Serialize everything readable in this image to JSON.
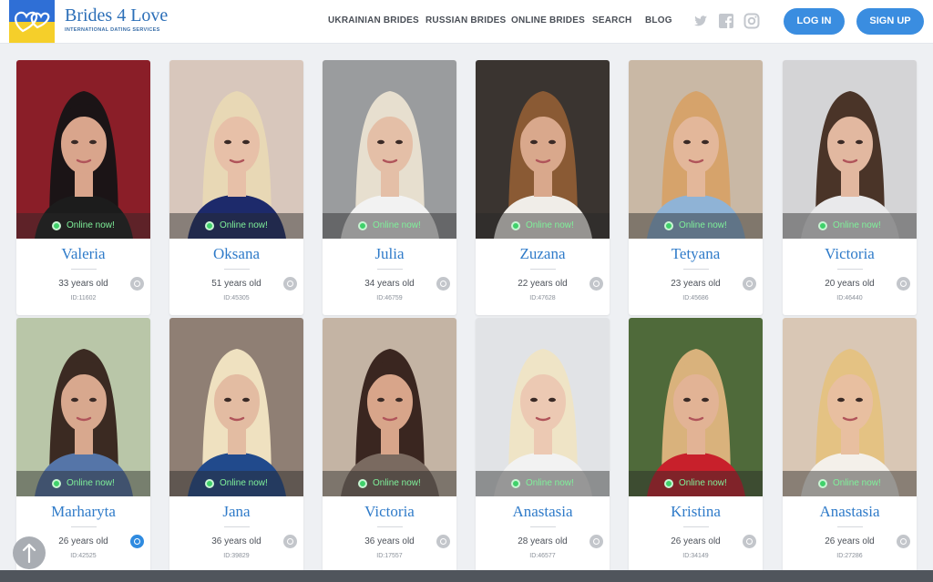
{
  "header": {
    "brand_name": "Brides 4 Love",
    "brand_tagline": "INTERNATIONAL DATING SERVICES",
    "nav": [
      {
        "label": "UKRAINIAN BRIDES"
      },
      {
        "label": "RUSSIAN BRIDES"
      },
      {
        "label": "ONLINE BRIDES"
      },
      {
        "label": "SEARCH"
      },
      {
        "label": "BLOG"
      }
    ],
    "social_icons": [
      "twitter-icon",
      "facebook-icon",
      "instagram-icon"
    ],
    "login_label": "LOG IN",
    "signup_label": "SIGN UP"
  },
  "colors": {
    "accent": "#3a8de0",
    "name_blue": "#2f7bc9",
    "online_green": "#3fd16a",
    "flag_blue": "#2f6fd6",
    "flag_yellow": "#f5cf2a"
  },
  "profiles": [
    {
      "name": "Valeria",
      "age": "33 years old",
      "id": "ID:11602",
      "status": "Online now!",
      "cam": "inactive"
    },
    {
      "name": "Oksana",
      "age": "51 years old",
      "id": "ID:45305",
      "status": "Online now!",
      "cam": "inactive"
    },
    {
      "name": "Julia",
      "age": "34 years old",
      "id": "ID:46759",
      "status": "Online now!",
      "cam": "inactive"
    },
    {
      "name": "Zuzana",
      "age": "22 years old",
      "id": "ID:47628",
      "status": "Online now!",
      "cam": "inactive"
    },
    {
      "name": "Tetyana",
      "age": "23 years old",
      "id": "ID:45686",
      "status": "Online now!",
      "cam": "inactive"
    },
    {
      "name": "Victoria",
      "age": "20 years old",
      "id": "ID:46440",
      "status": "Online now!",
      "cam": "inactive"
    },
    {
      "name": "Marharyta",
      "age": "26 years old",
      "id": "ID:42525",
      "status": "Online now!",
      "cam": "active"
    },
    {
      "name": "Jana",
      "age": "36 years old",
      "id": "ID:39829",
      "status": "Online now!",
      "cam": "inactive"
    },
    {
      "name": "Victoria",
      "age": "36 years old",
      "id": "ID:17557",
      "status": "Online now!",
      "cam": "inactive"
    },
    {
      "name": "Anastasia",
      "age": "28 years old",
      "id": "ID:46577",
      "status": "Online now!",
      "cam": "inactive"
    },
    {
      "name": "Kristina",
      "age": "26 years old",
      "id": "ID:34149",
      "status": "Online now!",
      "cam": "inactive"
    },
    {
      "name": "Anastasia",
      "age": "26 years old",
      "id": "ID:27286",
      "status": "Online now!",
      "cam": "inactive"
    }
  ],
  "scroll_top_icon": "arrow-up-icon"
}
